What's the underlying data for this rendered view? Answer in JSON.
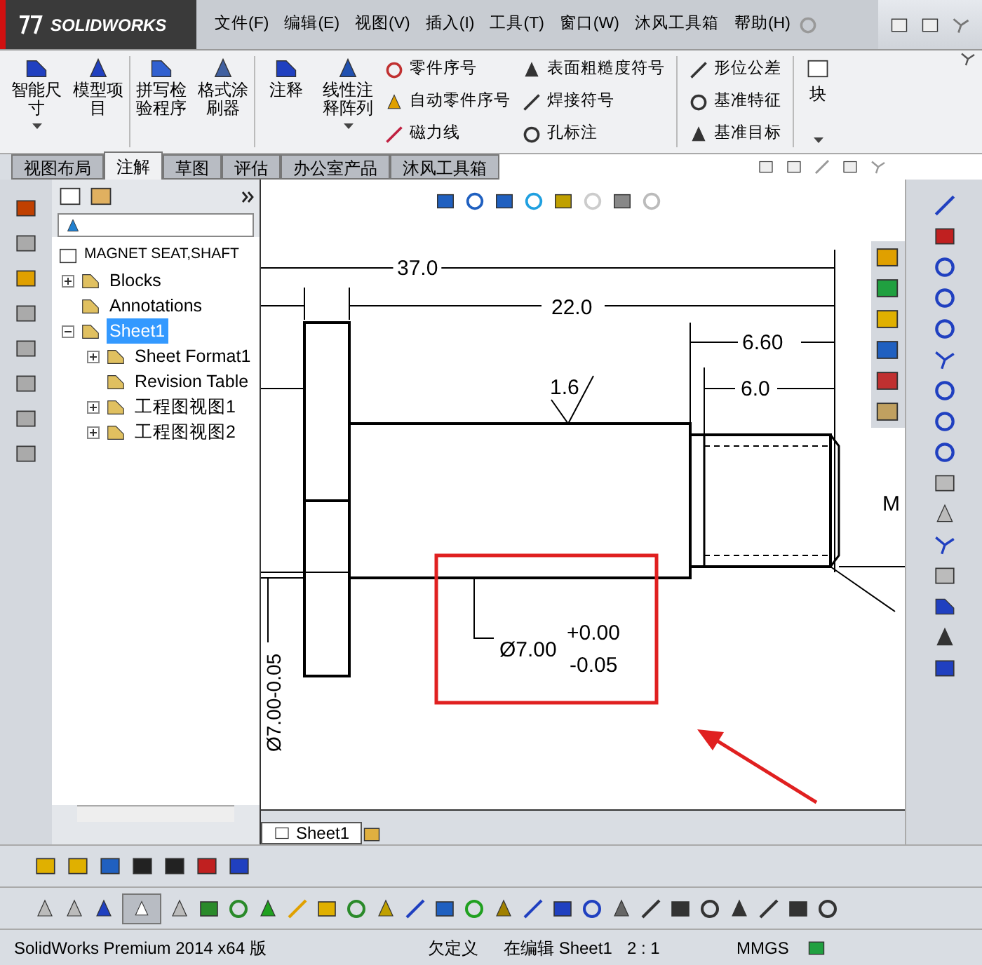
{
  "app": {
    "logo": "SOLIDWORKS"
  },
  "menu": [
    "文件(F)",
    "编辑(E)",
    "视图(V)",
    "插入(I)",
    "工具(T)",
    "窗口(W)",
    "沐风工具箱",
    "帮助(H)"
  ],
  "ribbon": {
    "large": [
      {
        "label": "智能尺寸",
        "dropdown": true
      },
      {
        "label": "模型项目",
        "dropdown": false
      },
      {
        "label": "拼写检验程序",
        "dropdown": false
      },
      {
        "label": "格式涂刷器",
        "dropdown": false
      },
      {
        "label": "注释",
        "dropdown": false
      },
      {
        "label": "线性注释阵列",
        "dropdown": true
      }
    ],
    "small": [
      [
        "零件序号",
        "自动零件序号",
        "磁力线"
      ],
      [
        "表面粗糙度符号",
        "焊接符号",
        "孔标注"
      ],
      [
        "形位公差",
        "基准特征",
        "基准目标"
      ]
    ],
    "block": {
      "label": "块",
      "dropdown": true
    }
  },
  "tabs": [
    {
      "label": "视图布局",
      "selected": false
    },
    {
      "label": "注解",
      "selected": true
    },
    {
      "label": "草图",
      "selected": false
    },
    {
      "label": "评估",
      "selected": false
    },
    {
      "label": "办公室产品",
      "selected": false
    },
    {
      "label": "沐风工具箱",
      "selected": false
    }
  ],
  "tree": {
    "root": "MAGNET SEAT,SHAFT",
    "items": [
      {
        "label": "Blocks",
        "expanded": false,
        "selected": false
      },
      {
        "label": "Annotations",
        "selected": false
      },
      {
        "label": "Sheet1",
        "expanded": true,
        "selected": true,
        "children": [
          {
            "label": "Sheet Format1",
            "expanded": false,
            "selected": false
          },
          {
            "label": "Revision Table",
            "selected": false
          },
          {
            "label": "工程图视图1",
            "expanded": false,
            "selected": false
          },
          {
            "label": "工程图视图2",
            "expanded": false,
            "selected": false
          }
        ]
      }
    ]
  },
  "drawing": {
    "dim_overall": "37.0",
    "dim_shaft": "22.0",
    "dim_thread_outer": "6.60",
    "dim_thread": "6.0",
    "roughness": "1.6",
    "diameter": "Ø7.00",
    "upper_tol": "+0.00",
    "lower_tol": "-0.05",
    "side_dim": "Ø7.00-0.05",
    "thread_label": "M"
  },
  "sheet_tabs": [
    {
      "label": "Sheet1",
      "selected": true
    }
  ],
  "status": [
    "SolidWorks Premium 2014 x64 版",
    "欠定义",
    "在编辑 Sheet1",
    "2 : 1",
    "MMGS"
  ]
}
